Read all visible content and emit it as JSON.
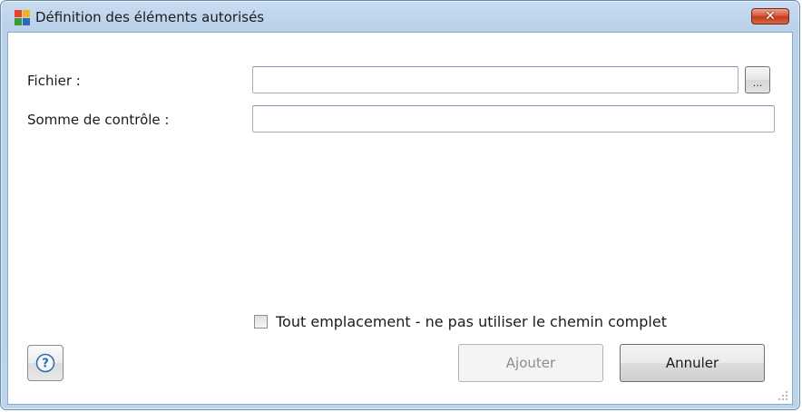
{
  "window": {
    "title": "Définition des éléments autorisés",
    "close_symbol": "✕"
  },
  "form": {
    "file_label": "Fichier :",
    "file_value": "",
    "browse_label": "...",
    "checksum_label": "Somme de contrôle :",
    "checksum_value": ""
  },
  "options": {
    "any_location_label": "Tout emplacement - ne pas utiliser le chemin complet",
    "any_location_checked": false
  },
  "buttons": {
    "add_label": "Ajouter",
    "add_enabled": false,
    "cancel_label": "Annuler"
  },
  "icons": {
    "app": "avg-logo-icon",
    "help": "help-icon",
    "close": "close-icon",
    "grip": "resize-grip-icon"
  },
  "colors": {
    "close_button": "#d8573d",
    "titlebar": "#c9dcf0",
    "help_icon": "#2a6aa8"
  }
}
